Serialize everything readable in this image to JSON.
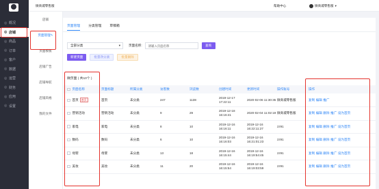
{
  "store": {
    "name": "微商城零售版"
  },
  "topbar": {
    "help": "帮助中心",
    "user": "微商城零售版"
  },
  "nav": [
    {
      "label": "概况",
      "icon": "home-icon"
    },
    {
      "label": "店铺",
      "icon": "store-icon",
      "active": true
    },
    {
      "label": "商品",
      "icon": "goods-icon"
    },
    {
      "label": "订单",
      "icon": "order-icon"
    },
    {
      "label": "客户",
      "icon": "customer-icon"
    },
    {
      "label": "数据",
      "icon": "data-icon"
    },
    {
      "label": "运营",
      "icon": "operate-icon"
    },
    {
      "label": "财务",
      "icon": "finance-icon"
    },
    {
      "label": "应用",
      "icon": "app-icon"
    },
    {
      "label": "设置",
      "icon": "settings-icon"
    }
  ],
  "subnav": [
    {
      "label": "店铺"
    },
    {
      "label": "页面管理",
      "active": true
    },
    {
      "label": "页面模板"
    },
    {
      "label": "店铺广告"
    },
    {
      "label": "店铺导航"
    },
    {
      "label": "店铺风格"
    },
    {
      "label": "我的文件"
    }
  ],
  "tabs": [
    "页面管理",
    "分类管理",
    "草稿箱"
  ],
  "filters": {
    "category": "全部分类",
    "name_label": "页面名称:",
    "name_placeholder": "请输入页面名称",
    "query": "查询"
  },
  "actions": {
    "new_page": "新建页面",
    "batch_category": "批量改分类",
    "batch_delete": "批量删除"
  },
  "count_text": "微页面 ( 共10个 )",
  "table": {
    "headers": [
      "页面名称",
      "页面标题",
      "所属分类",
      "访客数",
      "浏览数",
      "创建时间",
      "更新时间",
      "操作账号",
      "操作"
    ],
    "rows": [
      {
        "name": "首页",
        "badge": "首页",
        "title": "首页",
        "category": "未分类",
        "visitors": "247",
        "views": "1138",
        "created": "2019-12-17 17:22:11",
        "updated": "2020-02-06 11:30:35",
        "account": "微商城零售版",
        "ops": [
          "复制",
          "编辑",
          "推广"
        ]
      },
      {
        "name": "营销活动",
        "badge": "",
        "title": "营销活动",
        "category": "未分类",
        "visitors": "9",
        "views": "29",
        "created": "2019-12-18 16:16:41",
        "updated": "2020-02-04 11:02:19",
        "account": "微商城零售版",
        "ops": [
          "复制",
          "编辑",
          "删除",
          "推广",
          "设为首页"
        ]
      },
      {
        "name": "家电",
        "badge": "",
        "title": "家电",
        "category": "未分类",
        "visitors": "8",
        "views": "10",
        "created": "2019-12-16 16:16:11",
        "updated": "2019-12-16 16:22:11:27",
        "account": "zz91",
        "ops": [
          "复制",
          "编辑",
          "删除",
          "推广",
          "设为首页"
        ]
      },
      {
        "name": "数码",
        "badge": "",
        "title": "数码",
        "category": "未分类",
        "visitors": "6",
        "views": "10",
        "created": "2019-12-16 16:16:03",
        "updated": "2019-12-16 16:21:01:23",
        "account": "zz91",
        "ops": [
          "复制",
          "编辑",
          "删除",
          "推广",
          "设为首页"
        ]
      },
      {
        "name": "母婴",
        "badge": "",
        "title": "母婴",
        "category": "未分类",
        "visitors": "13",
        "views": "18",
        "created": "2019-12-16 16:15:44",
        "updated": "2019-12-16 16:19:54:45",
        "account": "zz91",
        "ops": [
          "复制",
          "编辑",
          "删除",
          "推广",
          "设为首页"
        ]
      },
      {
        "name": "美妆",
        "badge": "",
        "title": "美妆",
        "category": "未分类",
        "visitors": "11",
        "views": "20",
        "created": "2019-12-16 16:15:54",
        "updated": "2019-12-16 16:19:03:59",
        "account": "zz91",
        "ops": [
          "复制",
          "编辑",
          "删除",
          "推广",
          "设为首页"
        ]
      }
    ]
  },
  "colors": {
    "accent": "#2f86f6",
    "primary_button": "#7c5cf0",
    "highlight": "#e4322c",
    "sidebar": "#2b2d38"
  }
}
